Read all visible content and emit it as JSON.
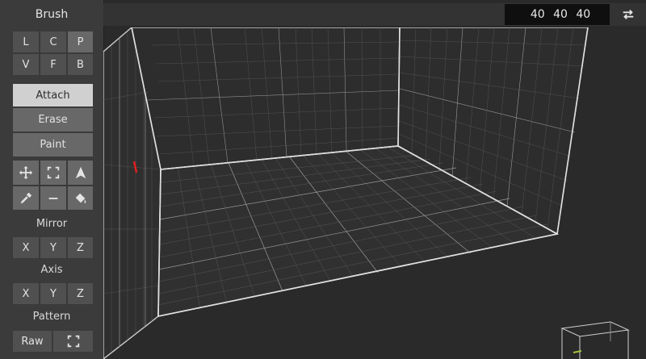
{
  "panel": {
    "title": "Brush",
    "modes": [
      "L",
      "C",
      "P",
      "V",
      "F",
      "B"
    ],
    "actions": [
      "Attach",
      "Erase",
      "Paint"
    ],
    "tools": [
      "move-icon",
      "select-icon",
      "pointer-icon",
      "eyedropper-icon",
      "line-icon",
      "bucket-icon"
    ],
    "mirror": {
      "label": "Mirror",
      "buttons": [
        "X",
        "Y",
        "Z"
      ]
    },
    "axis": {
      "label": "Axis",
      "buttons": [
        "X",
        "Y",
        "Z"
      ]
    },
    "pattern": {
      "label": "Pattern",
      "raw_label": "Raw"
    }
  },
  "topbar": {
    "size_value": "40 40 40"
  },
  "colors": {
    "accent_red": "#e02020",
    "selected_bg": "#d0d0d0",
    "grid_line": "#9a9a9a"
  }
}
